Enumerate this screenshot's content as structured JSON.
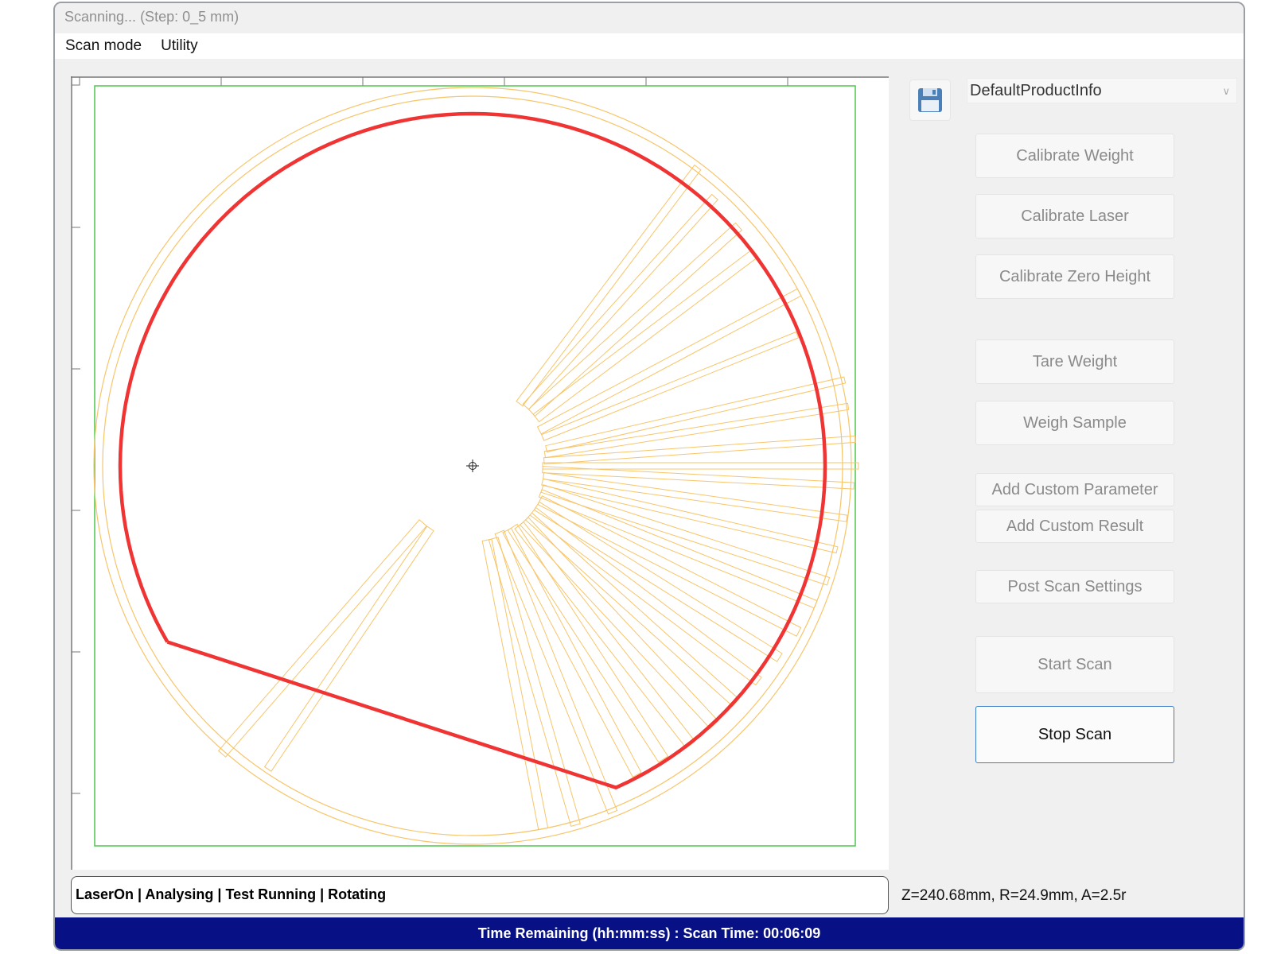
{
  "window": {
    "title": "Scanning...  (Step: 0_5 mm)"
  },
  "menu": {
    "items": [
      "Scan mode",
      "Utility"
    ]
  },
  "product": {
    "selected": "DefaultProductInfo",
    "save_icon": "floppy-disk-icon",
    "chevron_icon": "chevron-down-icon"
  },
  "buttons": {
    "calibrate_weight": "Calibrate Weight",
    "calibrate_laser": "Calibrate Laser",
    "calibrate_zero_height": "Calibrate Zero Height",
    "tare_weight": "Tare Weight",
    "weigh_sample": "Weigh Sample",
    "add_custom_parameter": "Add Custom Parameter",
    "add_custom_result": "Add Custom Result",
    "post_scan_settings": "Post Scan Settings",
    "start_scan": "Start Scan",
    "stop_scan": "Stop Scan"
  },
  "status": {
    "flags": "LaserOn | Analysing | Test Running | Rotating",
    "coordinates": "Z=240.68mm, R=24.9mm, A=2.5r"
  },
  "footer": {
    "text": "Time Remaining (hh:mm:ss) : Scan Time: 00:06:09"
  },
  "colors": {
    "profile": "#f03434",
    "scan_lines": "#f7c56a",
    "bounds": "#4cc94c",
    "footer_bg": "#071185",
    "active_border": "#3b7dc8"
  }
}
